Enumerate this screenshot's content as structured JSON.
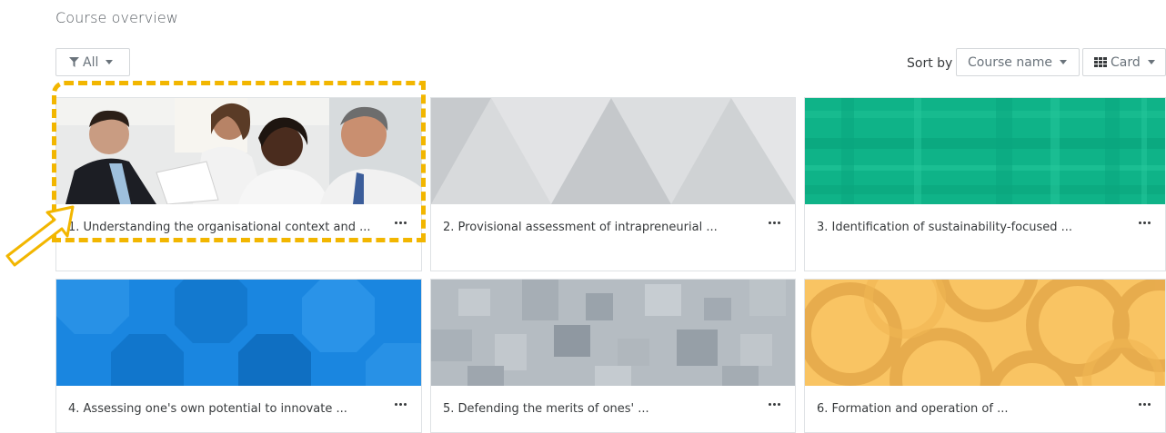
{
  "section": {
    "title": "Course overview"
  },
  "filter": {
    "label": "All"
  },
  "sort": {
    "prefix": "Sort by",
    "value": "Course name"
  },
  "view": {
    "label": "Card"
  },
  "courses": [
    {
      "name": "1. Understanding the organisational context and ...",
      "image": "photo of business people"
    },
    {
      "name": "2. Provisional assessment of intrapreneurial ...",
      "image": "grey triangle pattern"
    },
    {
      "name": "3. Identification of sustainability-focused ...",
      "image": "green plaid pattern"
    },
    {
      "name": "4. Assessing one's own potential to innovate ...",
      "image": "blue octagon pattern"
    },
    {
      "name": "5. Defending the merits of ones' ...",
      "image": "grey squares pattern"
    },
    {
      "name": "6. Formation and operation of ...",
      "image": "yellow rings pattern"
    }
  ],
  "colors": {
    "highlight": "#f2b600",
    "green": "#0fb388",
    "blue": "#1a86e0",
    "yellow": "#f9c463"
  }
}
